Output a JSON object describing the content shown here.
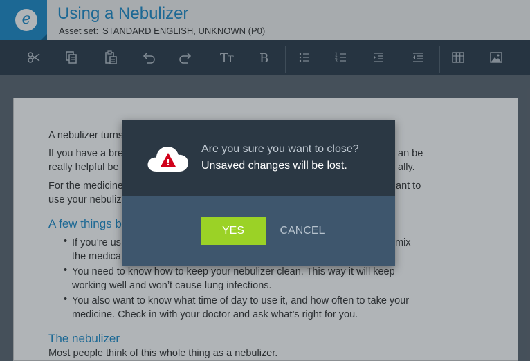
{
  "header": {
    "title": "Using a Nebulizer",
    "asset_label": "Asset set:",
    "asset_value": "STANDARD ENGLISH, UNKNOWN (P0)"
  },
  "toolbar": {
    "items": [
      "scissors-icon",
      "copy-icon",
      "paste-icon",
      "undo-icon",
      "redo-icon",
      "font-size-icon",
      "bold-icon",
      "bullet-list-icon",
      "numbered-list-icon",
      "indent-icon",
      "outdent-icon",
      "table-icon",
      "image-icon"
    ]
  },
  "document": {
    "p1": "A nebulizer turns",
    "p2a": "If you have a bre",
    "p2a_end": "an be",
    "p2b": "really helpful be",
    "p2b_end": "ally.",
    "p3a": "For the medicine",
    "p3a_end": "ant to",
    "p3b": "use your nebuliz",
    "h1": "A few things b",
    "b1a": "If you’re us",
    "b1a_end": "mix",
    "b1b": "the medica",
    "b2a": "You need to know how to keep your nebulizer clean. This way it will keep",
    "b2b": "working well and won’t cause lung infections.",
    "b3a": "You also want to know what time of day to use it, and how often to take your",
    "b3b": "medicine. Check in with your doctor and ask what’s right for you.",
    "h2": "The nebulizer",
    "p4": "Most people think of this whole thing as a nebulizer.",
    "bullet_char": "•"
  },
  "dialog": {
    "question": "Are you sure you want to close?",
    "warning": "Unsaved changes will be lost.",
    "yes_label": "YES",
    "cancel_label": "CANCEL",
    "icon": "cloud-warning-icon",
    "icon_mark": "!"
  },
  "colors": {
    "brand": "#1c8bc9",
    "toolbar": "#2b3b4b",
    "yes_button": "#9bd226",
    "warning": "#d0021b"
  }
}
